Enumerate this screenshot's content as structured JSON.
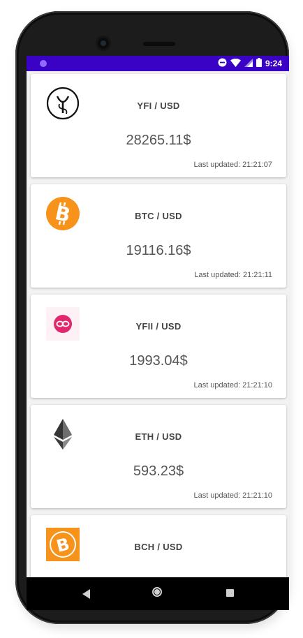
{
  "status_bar": {
    "time": "9:24",
    "icons": [
      "dnd-icon",
      "wifi-icon",
      "signal-icon",
      "battery-icon"
    ]
  },
  "colors": {
    "status_bar": "#3a02c4",
    "btc": "#f7931a",
    "yfii": "#e2286c",
    "eth": "#343434"
  },
  "cards": [
    {
      "icon": "yfi-logo-icon",
      "pair": "YFI / USD",
      "price": "28265.11$",
      "updated": "Last updated: 21:21:07"
    },
    {
      "icon": "btc-logo-icon",
      "pair": "BTC / USD",
      "price": "19116.16$",
      "updated": "Last updated: 21:21:11"
    },
    {
      "icon": "yfii-logo-icon",
      "pair": "YFII / USD",
      "price": "1993.04$",
      "updated": "Last updated: 21:21:10"
    },
    {
      "icon": "eth-logo-icon",
      "pair": "ETH / USD",
      "price": "593.23$",
      "updated": "Last updated: 21:21:10"
    },
    {
      "icon": "bch-logo-icon",
      "pair": "BCH / USD",
      "price": "",
      "updated": ""
    }
  ],
  "nav": {
    "back": "back-icon",
    "home": "home-icon",
    "recents": "recents-icon"
  }
}
